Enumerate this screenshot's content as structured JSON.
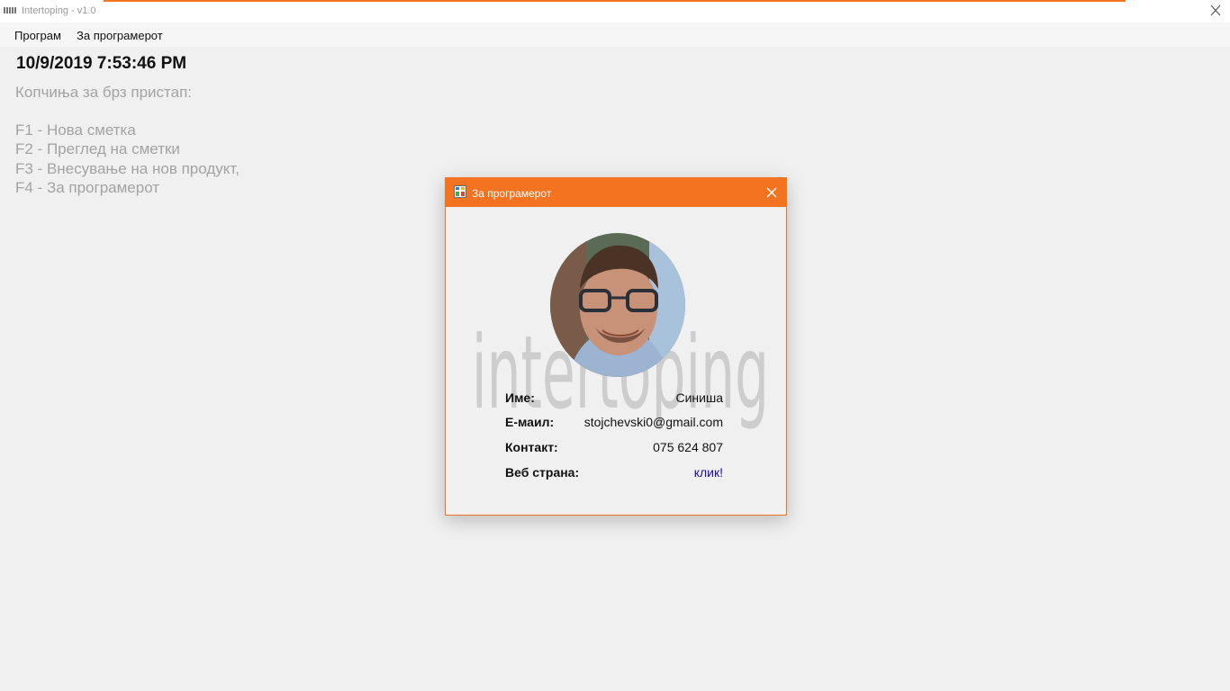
{
  "window": {
    "title": "Intertoping - v1.0"
  },
  "menu": {
    "items": [
      {
        "label": "Програм"
      },
      {
        "label": "За програмерот"
      }
    ]
  },
  "main": {
    "datetime": "10/9/2019 7:53:46 PM",
    "shortcuts_heading": "Копчиња за брз пристап:",
    "shortcuts": [
      "F1 - Нова сметка",
      "F2 - Преглед на сметки",
      "F3 - Внесување на нов продукт,",
      "F4 - За програмерот"
    ]
  },
  "dialog": {
    "title": "За програмерот",
    "watermark": "intertoping",
    "fields": [
      {
        "label": "Име:",
        "value": "Синиша"
      },
      {
        "label": "Е-маил:",
        "value": "stojchevski0@gmail.com"
      },
      {
        "label": "Контакт:",
        "value": "075 624 807"
      },
      {
        "label": "Веб страна:",
        "value": "клик!"
      }
    ]
  },
  "colors": {
    "accent": "#f47321",
    "link": "#1a0dab",
    "muted_text": "#a3a3a3"
  }
}
